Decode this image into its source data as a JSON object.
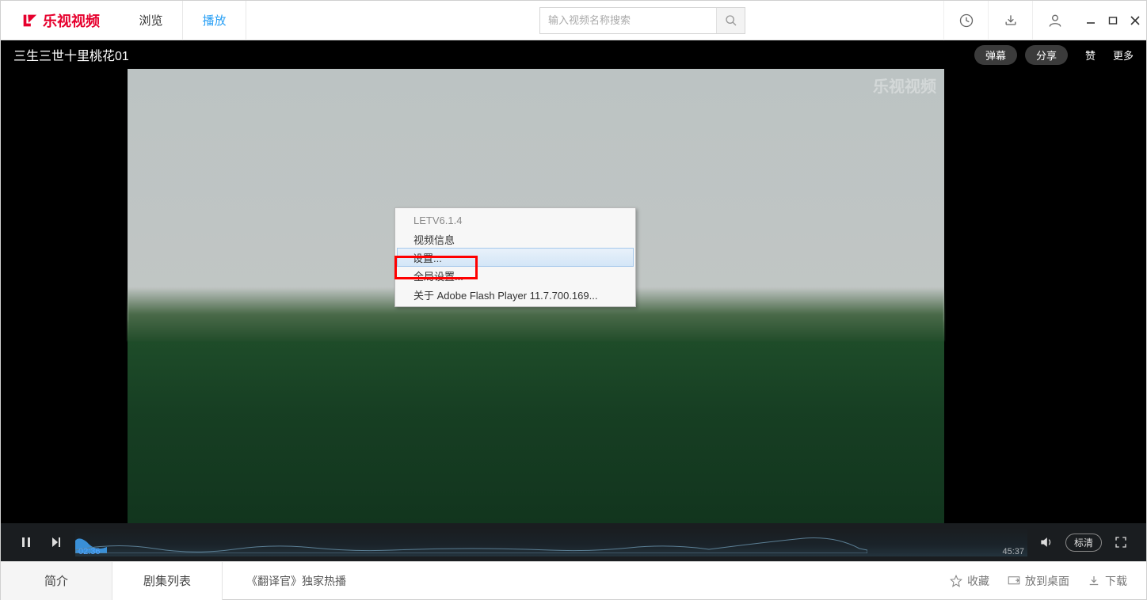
{
  "app_name": "乐视视频",
  "tabs": {
    "browse": "浏览",
    "play": "播放"
  },
  "search": {
    "placeholder": "输入视频名称搜索"
  },
  "video": {
    "title": "三生三世十里桃花01",
    "danmu": "弹幕",
    "share": "分享",
    "like": "赞",
    "more": "更多",
    "watermark": "乐视视频"
  },
  "player": {
    "currentTime": "02:36",
    "duration": "45:37",
    "quality": "标清"
  },
  "context_menu": {
    "version": "LETV6.1.4",
    "video_info": "视频信息",
    "settings": "设置...",
    "global_settings": "全局设置...",
    "about_flash": "关于 Adobe Flash Player 11.7.700.169..."
  },
  "bottom": {
    "tab_intro": "简介",
    "tab_episodes": "剧集列表",
    "promo": "《翻译官》独家热播",
    "favorite": "收藏",
    "to_desktop": "放到桌面",
    "download": "下载"
  }
}
